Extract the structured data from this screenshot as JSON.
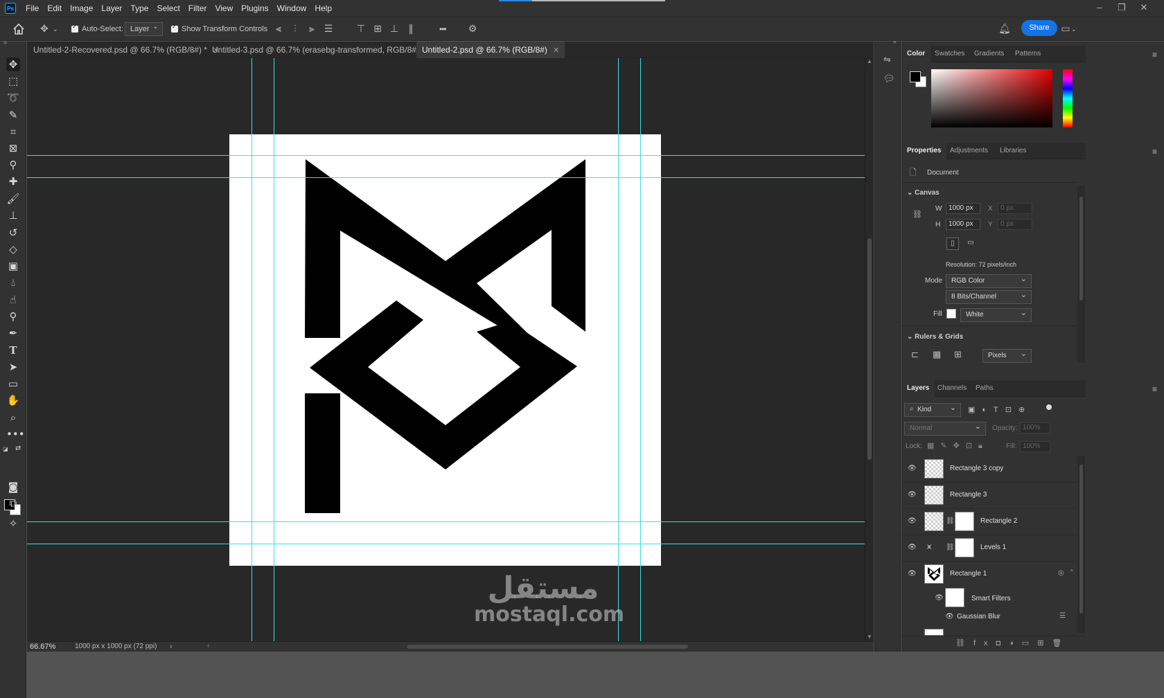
{
  "menubar": {
    "logo": "Ps",
    "items": [
      "File",
      "Edit",
      "Image",
      "Layer",
      "Type",
      "Select",
      "Filter",
      "View",
      "Plugins",
      "Window",
      "Help"
    ]
  },
  "optionsbar": {
    "auto_select_label": "Auto-Select:",
    "auto_select_target": "Layer",
    "show_transform_label": "Show Transform Controls",
    "more_label": "•••",
    "share_label": "Share"
  },
  "tabs": [
    {
      "label": "Untitled-2-Recovered.psd @ 66.7% (RGB/8#) *"
    },
    {
      "label": "Untitled-3.psd @ 66.7% (erasebg-transformed, RGB/8#)"
    },
    {
      "label": "Untitled-2.psd @ 66.7% (RGB/8#)"
    }
  ],
  "watermark": {
    "arabic": "مستقل",
    "latin": "mostaql.com"
  },
  "status": {
    "zoom": "66.67%",
    "doc_info": "1000 px x 1000 px (72 ppi)"
  },
  "color_panel": {
    "tabs": [
      "Color",
      "Swatches",
      "Gradients",
      "Patterns"
    ],
    "foreground": "#000000",
    "background": "#ffffff"
  },
  "properties_panel": {
    "tabs": [
      "Properties",
      "Adjustments",
      "Libraries"
    ],
    "doc_label": "Document",
    "canvas_section": "Canvas",
    "w_label": "W",
    "w_value": "1000 px",
    "h_label": "H",
    "h_value": "1000 px",
    "x_label": "X",
    "x_value": "0 px",
    "y_label": "Y",
    "y_value": "0 px",
    "resolution": "Resolution: 72 pixels/inch",
    "mode_label": "Mode",
    "mode_value": "RGB Color",
    "bits_value": "8 Bits/Channel",
    "fill_label": "Fill",
    "fill_value": "White",
    "rulers_section": "Rulers & Grids",
    "units_value": "Pixels"
  },
  "layers_panel": {
    "tabs": [
      "Layers",
      "Channels",
      "Paths"
    ],
    "filter_kind": "Kind",
    "blend_mode": "Normal",
    "opacity_label": "Opacity:",
    "opacity_value": "100%",
    "lock_label": "Lock:",
    "fill_label": "Fill:",
    "fill_value": "100%",
    "layers": [
      {
        "name": "Rectangle 3 copy"
      },
      {
        "name": "Rectangle 3"
      },
      {
        "name": "Rectangle 2"
      },
      {
        "name": "Levels 1"
      },
      {
        "name": "Rectangle 1"
      },
      {
        "name": "Smart Filters"
      },
      {
        "name": "Gaussian Blur"
      }
    ]
  },
  "colors": {
    "accent": "#1473e6",
    "guide": "#38e0e6",
    "panel": "#323232",
    "canvas_bg": "#282828"
  }
}
